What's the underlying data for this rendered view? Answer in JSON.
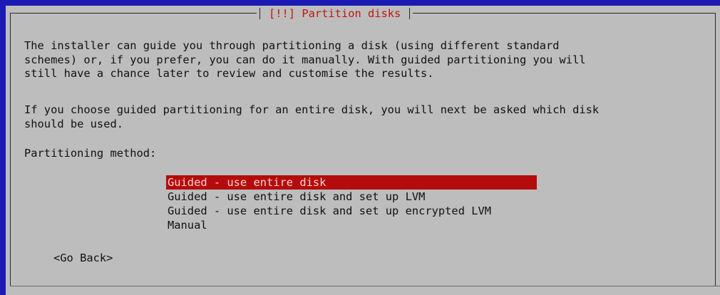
{
  "dialog": {
    "title": "[!!] Partition disks",
    "paragraph1": "The installer can guide you through partitioning a disk (using different standard\nschemes) or, if you prefer, you can do it manually. With guided partitioning you will\nstill have a chance later to review and customise the results.",
    "paragraph2": "If you choose guided partitioning for an entire disk, you will next be asked which disk\nshould be used.",
    "method_label": "Partitioning method:",
    "options": [
      {
        "label": "Guided - use entire disk",
        "selected": true
      },
      {
        "label": "Guided - use entire disk and set up LVM",
        "selected": false
      },
      {
        "label": "Guided - use entire disk and set up encrypted LVM",
        "selected": false
      },
      {
        "label": "Manual",
        "selected": false
      }
    ],
    "go_back_label": "<Go Back>"
  },
  "colors": {
    "background": "#bdbdbd",
    "edge": "#1b1bb3",
    "title_text": "#c41414",
    "selection_bg": "#b40c0c"
  }
}
